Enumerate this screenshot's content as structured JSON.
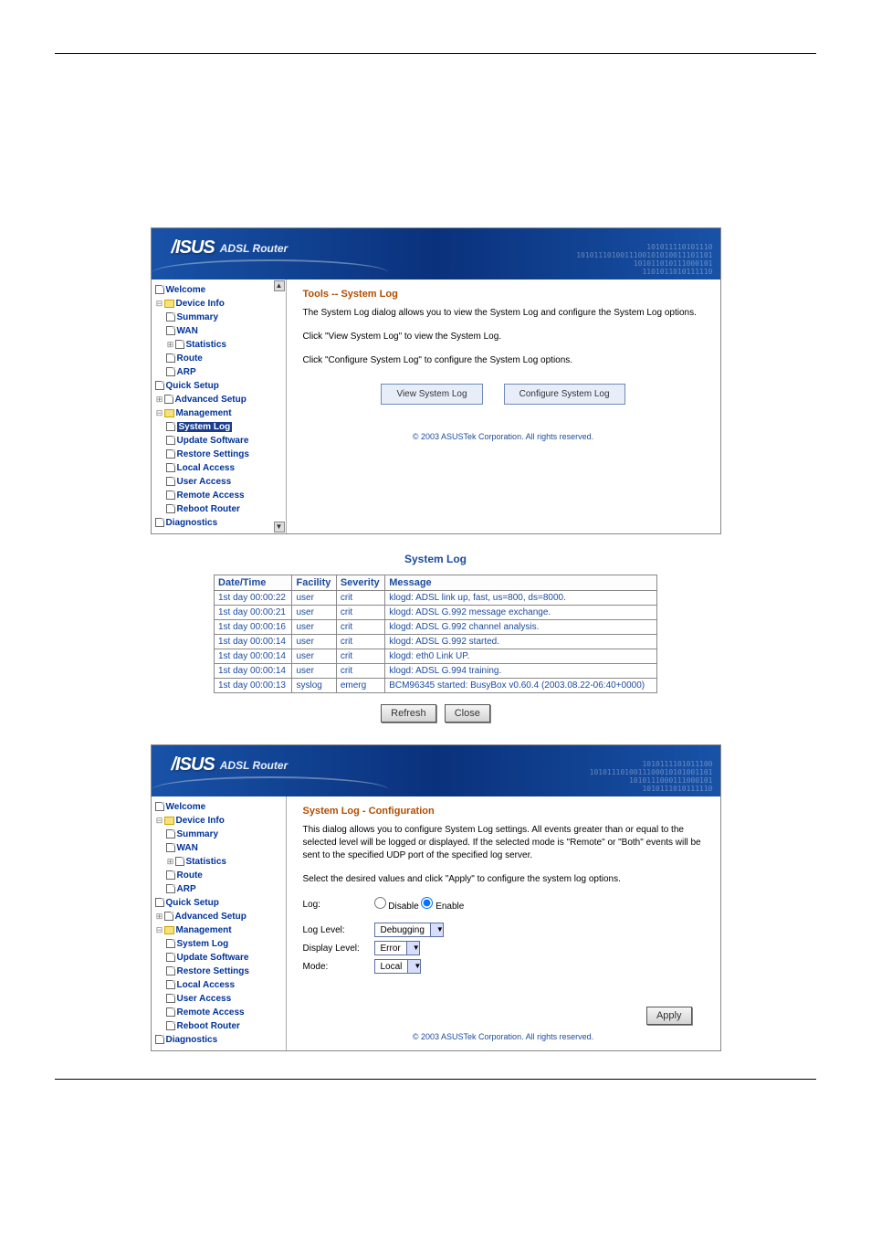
{
  "panel1": {
    "logo_sub": "ADSL Router",
    "tree": {
      "welcome": "Welcome",
      "device": "Device Info",
      "summary": "Summary",
      "wan": "WAN",
      "stats": "Statistics",
      "route": "Route",
      "arp": "ARP",
      "quick": "Quick Setup",
      "adv": "Advanced Setup",
      "mgmt": "Management",
      "syslog": "System Log",
      "updatesw": "Update Software",
      "restore": "Restore Settings",
      "localacc": "Local Access",
      "useracc": "User Access",
      "remoteacc": "Remote Access",
      "reboot": "Reboot Router",
      "diag": "Diagnostics"
    },
    "title": "Tools -- System Log",
    "p1": "The System Log dialog allows you to view the System Log and configure the System Log options.",
    "p2": "Click \"View System Log\" to view the System Log.",
    "p3": "Click \"Configure System Log\" to configure the System Log options.",
    "btn_view": "View System Log",
    "btn_conf": "Configure System Log",
    "copyright": "© 2003 ASUSTek Corporation. All rights reserved."
  },
  "logtable": {
    "title": "System Log",
    "headers": {
      "dt": "Date/Time",
      "fac": "Facility",
      "sev": "Severity",
      "msg": "Message"
    },
    "rows": [
      {
        "dt": "1st day 00:00:22",
        "fac": "user",
        "sev": "crit",
        "msg": "klogd: ADSL link up, fast, us=800, ds=8000."
      },
      {
        "dt": "1st day 00:00:21",
        "fac": "user",
        "sev": "crit",
        "msg": "klogd: ADSL G.992 message exchange."
      },
      {
        "dt": "1st day 00:00:16",
        "fac": "user",
        "sev": "crit",
        "msg": "klogd: ADSL G.992 channel analysis."
      },
      {
        "dt": "1st day 00:00:14",
        "fac": "user",
        "sev": "crit",
        "msg": "klogd: ADSL G.992 started."
      },
      {
        "dt": "1st day 00:00:14",
        "fac": "user",
        "sev": "crit",
        "msg": "klogd: eth0 Link UP."
      },
      {
        "dt": "1st day 00:00:14",
        "fac": "user",
        "sev": "crit",
        "msg": "klogd: ADSL G.994 training."
      },
      {
        "dt": "1st day 00:00:13",
        "fac": "syslog",
        "sev": "emerg",
        "msg": "BCM96345 started: BusyBox v0.60.4 (2003.08.22-06:40+0000)"
      }
    ],
    "refresh": "Refresh",
    "close": "Close"
  },
  "panel2": {
    "logo_sub": "ADSL Router",
    "title": "System Log - Configuration",
    "p1": "This dialog allows you to configure System Log settings. All events greater than or equal to the selected level will be logged or displayed. If the selected mode is \"Remote\" or \"Both\" events will be sent to the specified UDP port of the specified log server.",
    "p2": "Select the desired values and click \"Apply\" to configure the system log options.",
    "log_lbl": "Log:",
    "disable": "Disable",
    "enable": "Enable",
    "loglevel_lbl": "Log Level:",
    "loglevel_val": "Debugging",
    "displevel_lbl": "Display Level:",
    "displevel_val": "Error",
    "mode_lbl": "Mode:",
    "mode_val": "Local",
    "apply": "Apply",
    "copyright": "© 2003 ASUSTek Corporation. All rights reserved."
  }
}
